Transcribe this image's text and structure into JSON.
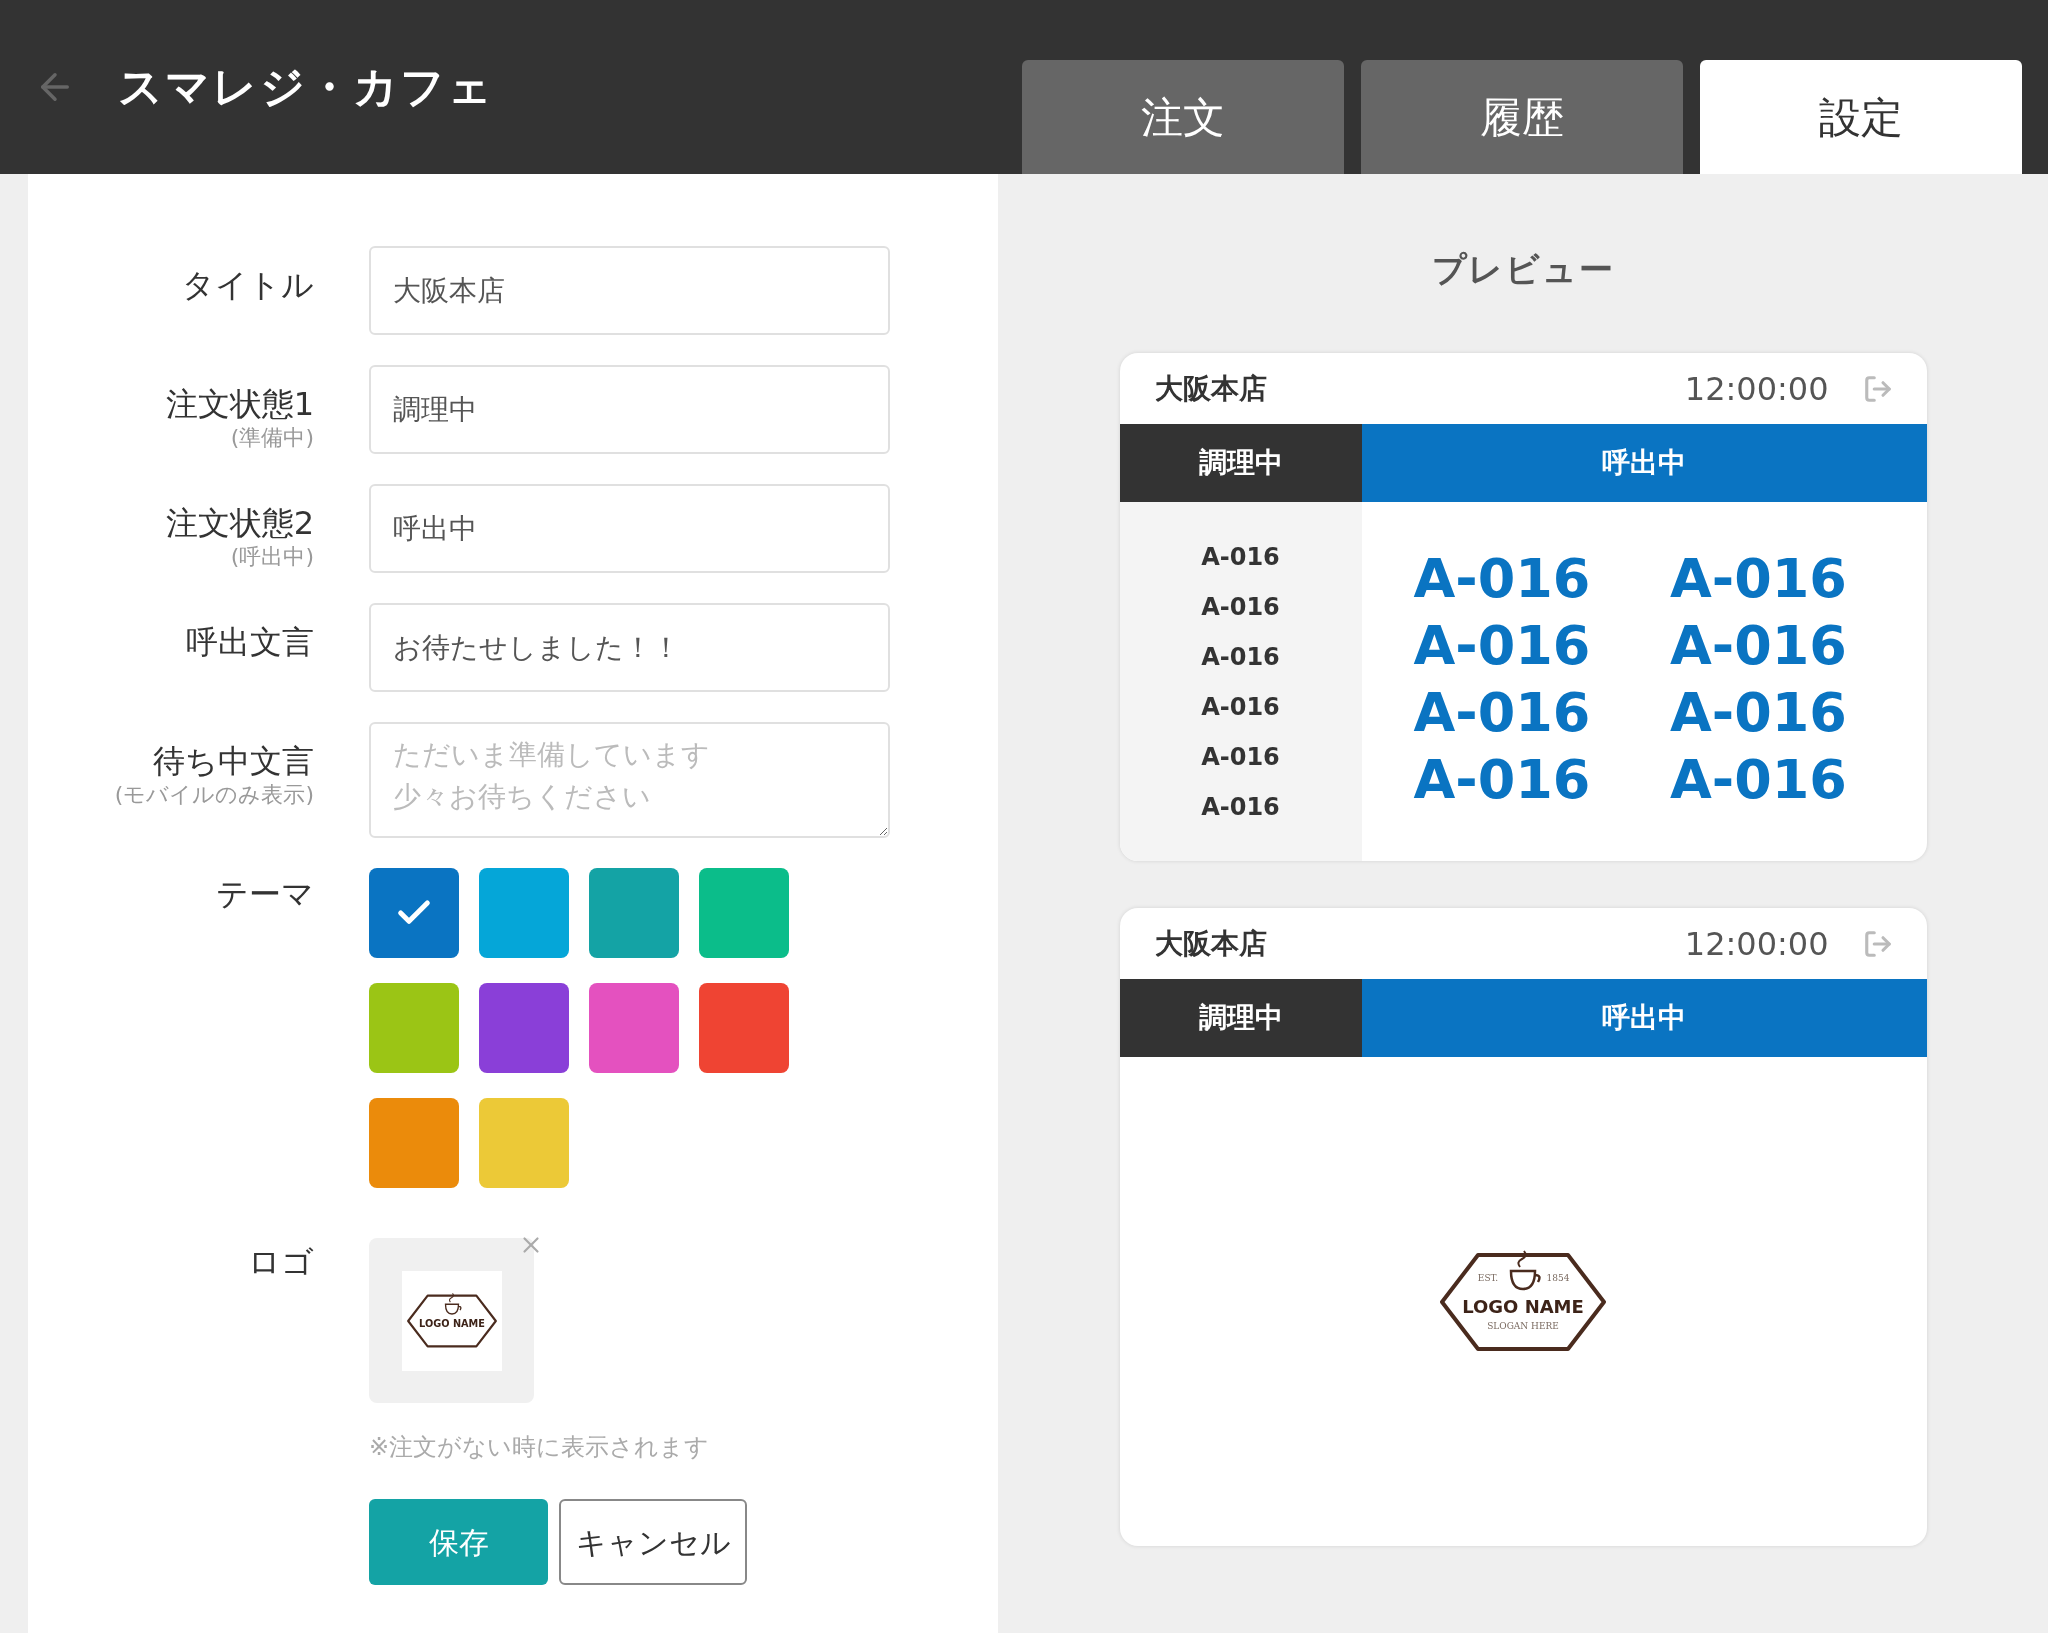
{
  "header": {
    "title": "スマレジ・カフェ"
  },
  "tabs": [
    {
      "label": "注文",
      "selected": false
    },
    {
      "label": "履歴",
      "selected": false
    },
    {
      "label": "設定",
      "selected": true
    }
  ],
  "form": {
    "fields": [
      {
        "kind": "input",
        "label": "タイトル",
        "value": "大阪本店"
      },
      {
        "kind": "input",
        "label": "注文状態1",
        "sublabel": "(準備中)",
        "value": "調理中"
      },
      {
        "kind": "input",
        "label": "注文状態2",
        "sublabel": "(呼出中)",
        "value": "呼出中"
      },
      {
        "kind": "input",
        "label": "呼出文言",
        "value": "お待たせしました！！"
      },
      {
        "kind": "textarea",
        "label": "待ち中文言",
        "sublabel": "(モバイルのみ表示)",
        "placeholder": "ただいま準備しています少々お待ちください"
      }
    ],
    "theme": {
      "label": "テーマ",
      "swatches": [
        {
          "color": "#0a74c2",
          "selected": true
        },
        {
          "color": "#05a6d8",
          "selected": false
        },
        {
          "color": "#14a3a5",
          "selected": false
        },
        {
          "color": "#0bbd8a",
          "selected": false
        },
        {
          "color": "#9bc515",
          "selected": false
        },
        {
          "color": "#8a3fd8",
          "selected": false
        },
        {
          "color": "#e451bf",
          "selected": false
        },
        {
          "color": "#ef4433",
          "selected": false
        },
        {
          "color": "#eb8b0b",
          "selected": false
        },
        {
          "color": "#ecc937",
          "selected": false
        }
      ]
    },
    "logo": {
      "label": "ロゴ",
      "image": {
        "name": "LOGO NAME"
      },
      "note": "※注文がない時に表示されます"
    },
    "buttons": [
      {
        "kind": "primary",
        "label": "保存"
      },
      {
        "kind": "secondary",
        "label": "キャンセル"
      }
    ]
  },
  "preview": {
    "title": "プレビュー",
    "cards": [
      {
        "kind": "list",
        "store": "大阪本店",
        "time": "12:00:00",
        "status_1": "調理中",
        "status_2": "呼出中",
        "preparing": [
          "A-016",
          "A-016",
          "A-016",
          "A-016",
          "A-016",
          "A-016"
        ],
        "calling": [
          "A-016",
          "A-016",
          "A-016",
          "A-016",
          "A-016",
          "A-016",
          "A-016",
          "A-016"
        ]
      },
      {
        "kind": "logo",
        "store": "大阪本店",
        "time": "12:00:00",
        "status_1": "調理中",
        "status_2": "呼出中",
        "logo": {
          "est": "EST.",
          "year": "1854",
          "name": "LOGO NAME",
          "slogan": "SLOGAN HERE"
        }
      }
    ]
  }
}
